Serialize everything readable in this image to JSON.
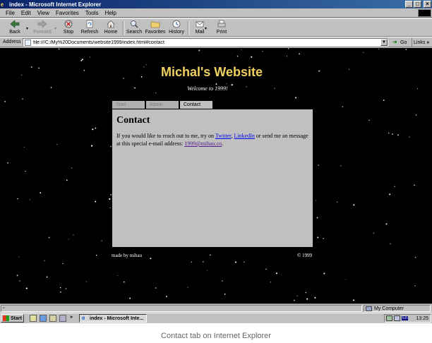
{
  "window": {
    "title": "index - Microsoft Internet Explorer",
    "controls": {
      "minimize": "_",
      "maximize": "□",
      "close": "×"
    }
  },
  "menubar": {
    "items": [
      "File",
      "Edit",
      "View",
      "Favorites",
      "Tools",
      "Help"
    ]
  },
  "toolbar": {
    "back": "Back",
    "forward": "Forward",
    "stop": "Stop",
    "refresh": "Refresh",
    "home": "Home",
    "search": "Search",
    "favorites": "Favorites",
    "history": "History",
    "mail": "Mail",
    "print": "Print"
  },
  "addressbar": {
    "label": "Address",
    "url": "file:///C:/My%20Documents/website1999/index.html#contact",
    "go_label": "Go",
    "links_label": "Links",
    "links_chevron": "»"
  },
  "page": {
    "title": "Michal's Website",
    "subtitle": "Welcome to 1999!",
    "tabs": [
      {
        "label": "Start",
        "active": false
      },
      {
        "label": "About",
        "active": false
      },
      {
        "label": "Contact",
        "active": true
      }
    ],
    "content": {
      "heading": "Contact",
      "text_1": "If you would like to reach out to me, try on ",
      "link_twitter": "Twitter",
      "text_2": ", ",
      "link_linkedin": "LinkedIn",
      "text_3": " or send me an message at this special e-mail address: ",
      "link_email": "1999@mihau.co",
      "text_4": "."
    },
    "footer": {
      "left": "made by mihau",
      "right": "© 1999"
    }
  },
  "statusbar": {
    "zone": "My Computer"
  },
  "taskbar": {
    "start_label": "Start",
    "quicklaunch_chevron": "»",
    "task_label": "index - Microsoft Inte...",
    "tray_lang": "En",
    "clock": "13:25"
  },
  "caption": "Contact tab on Internet Explorer",
  "colors": {
    "title_gradient_start": "#0a246a",
    "title_gradient_end": "#3a6ea5",
    "site_title": "#f0d060",
    "link": "#0000ee",
    "visited_link": "#551a8b",
    "chrome": "#c0c0c0"
  }
}
